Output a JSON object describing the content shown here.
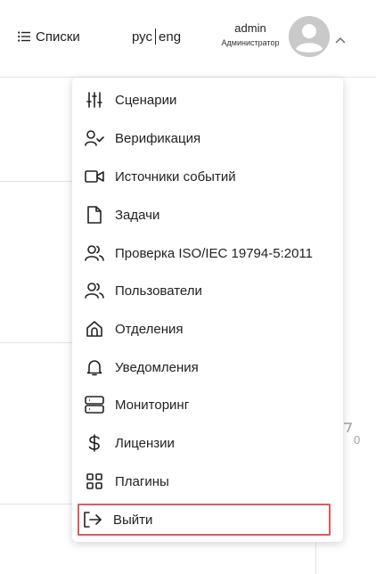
{
  "header": {
    "lists_label": "Списки",
    "lang_ru": "рус",
    "lang_en": "eng",
    "user_name": "admin",
    "user_role": "Администратор"
  },
  "background": {
    "right_value": "0"
  },
  "menu": {
    "items": [
      {
        "label": "Сценарии",
        "icon": "sliders-icon"
      },
      {
        "label": "Верификация",
        "icon": "user-check-icon"
      },
      {
        "label": "Источники событий",
        "icon": "video-camera-icon"
      },
      {
        "label": "Задачи",
        "icon": "file-icon"
      },
      {
        "label": "Проверка ISO/IEC 19794-5:2011",
        "icon": "users-icon"
      },
      {
        "label": "Пользователи",
        "icon": "users-icon"
      },
      {
        "label": "Отделения",
        "icon": "home-icon"
      },
      {
        "label": "Уведомления",
        "icon": "bell-icon"
      },
      {
        "label": "Мониторинг",
        "icon": "server-icon"
      },
      {
        "label": "Лицензии",
        "icon": "dollar-icon"
      },
      {
        "label": "Плагины",
        "icon": "grid-icon"
      },
      {
        "label": "Выйти",
        "icon": "logout-icon"
      }
    ]
  },
  "colors": {
    "highlight_border": "#e05a5e",
    "avatar": "#c9c9c9"
  }
}
